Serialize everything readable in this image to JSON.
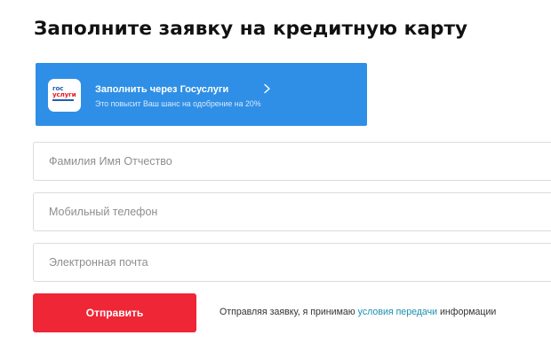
{
  "title": "Заполните заявку на кредитную карту",
  "gosuslugi": {
    "logo_line1": "гос",
    "logo_line2": "услуги",
    "title": "Заполнить через Госуслуги",
    "subtitle": "Это повысит Ваш шанс на одобрение на 20%",
    "icon": "chevron-right-icon",
    "bg_color": "#2f8fe6"
  },
  "fields": {
    "fio_placeholder": "Фамилия Имя Отчество",
    "phone_placeholder": "Мобильный телефон",
    "email_placeholder": "Электронная почта"
  },
  "submit": {
    "label": "Отправить",
    "color": "#ee2636"
  },
  "consent": {
    "prefix": "Отправляя заявку, я принимаю ",
    "link1": "условия",
    "link2": "передачи",
    "suffix": " информации",
    "link_color": "#1a8fb0"
  }
}
